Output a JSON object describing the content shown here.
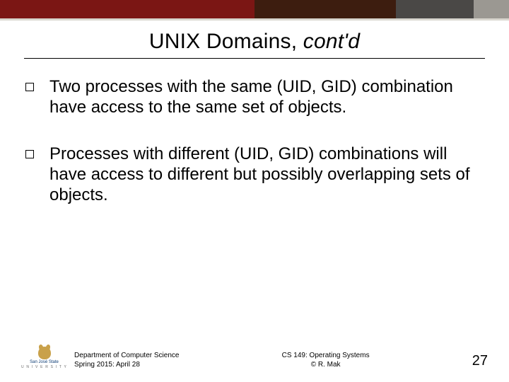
{
  "title": {
    "plain": "UNIX Domains, ",
    "italic": "cont'd"
  },
  "bullets": [
    "Two processes with the same (UID, GID) combination have access to the same set of objects.",
    "Processes with different (UID, GID) combinations will have access to different but possibly overlapping sets of objects."
  ],
  "footer": {
    "logo": {
      "line1": "San José State",
      "line2": "U N I V E R S I T Y"
    },
    "dept": {
      "line1": "Department of Computer Science",
      "line2": "Spring 2015: April 28"
    },
    "center": {
      "line1": "CS 149: Operating Systems",
      "line2": "© R. Mak"
    },
    "page": "27"
  }
}
